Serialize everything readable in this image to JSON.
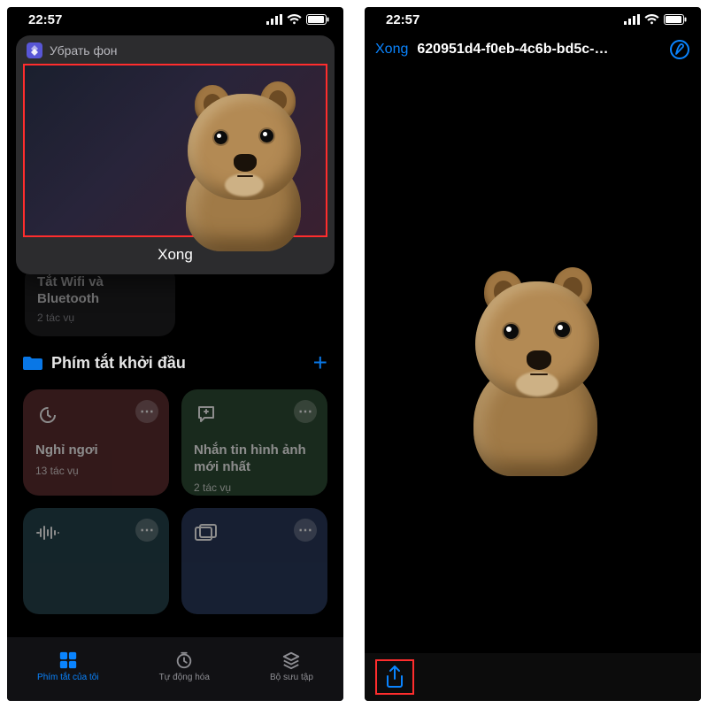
{
  "status": {
    "time": "22:57"
  },
  "left": {
    "overlay": {
      "app_label": "Убрать фон",
      "done": "Xong"
    },
    "stub_card": {
      "title": "Tắt Wifi và Bluetooth",
      "sub": "2 tác vụ"
    },
    "section": {
      "title": "Phím tắt khởi đầu"
    },
    "tiles": [
      {
        "title": "Nghỉ ngơi",
        "sub": "13 tác vụ"
      },
      {
        "title": "Nhắn tin hình ảnh mới nhất",
        "sub": "2 tác vụ"
      },
      {
        "title": "",
        "sub": ""
      },
      {
        "title": "",
        "sub": ""
      }
    ],
    "tabs": {
      "mine": "Phím tắt của tôi",
      "auto": "Tự động hóa",
      "gallery": "Bộ sưu tập"
    }
  },
  "right": {
    "back": "Xong",
    "filename": "620951d4-f0eb-4c6b-bd5c-…"
  }
}
